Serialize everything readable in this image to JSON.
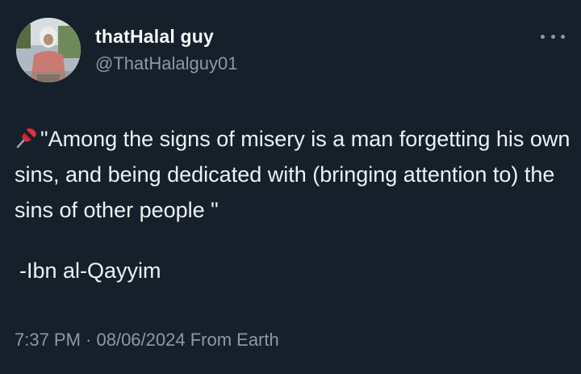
{
  "author": {
    "display_name": "thatHalal guy",
    "handle": "@ThatHalalguy01"
  },
  "tweet": {
    "pin_icon": "pushpin-icon",
    "text": "\"Among the signs of misery is a man forgetting his own sins, and being dedicated with (bringing attention to) the sins of other people \"",
    "attribution": "-Ibn al-Qayyim"
  },
  "meta": {
    "line": "7:37 PM · 08/06/2024 From Earth"
  },
  "colors": {
    "background": "#15202b",
    "text": "#e7e9ea",
    "secondary": "#8b98a5"
  }
}
